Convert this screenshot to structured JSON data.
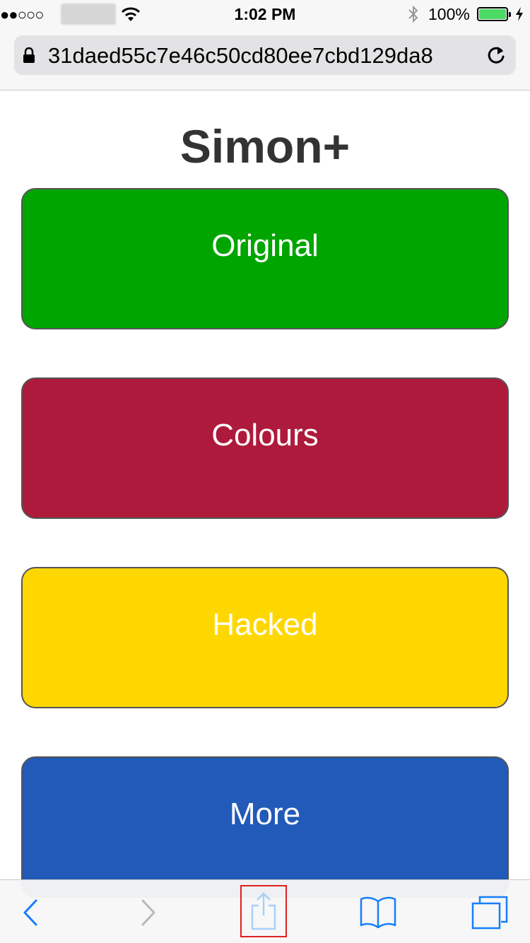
{
  "status_bar": {
    "signal": "●●○○○",
    "time": "1:02 PM",
    "battery_percent": "100%"
  },
  "browser": {
    "url": "31daed55c7e46c50cd80ee7cbd129da8"
  },
  "page": {
    "title": "Simon+",
    "buttons": [
      {
        "label": "Original",
        "color": "#00a500"
      },
      {
        "label": "Colours",
        "color": "#ae1a3c"
      },
      {
        "label": "Hacked",
        "color": "#ffd700"
      },
      {
        "label": "More",
        "color": "#215ab8"
      }
    ]
  },
  "toolbar": {
    "items": [
      {
        "icon": "back-chevron-icon"
      },
      {
        "icon": "forward-chevron-icon"
      },
      {
        "icon": "share-icon"
      },
      {
        "icon": "bookmarks-icon"
      },
      {
        "icon": "tabs-icon"
      }
    ],
    "accent": "#157efb"
  }
}
